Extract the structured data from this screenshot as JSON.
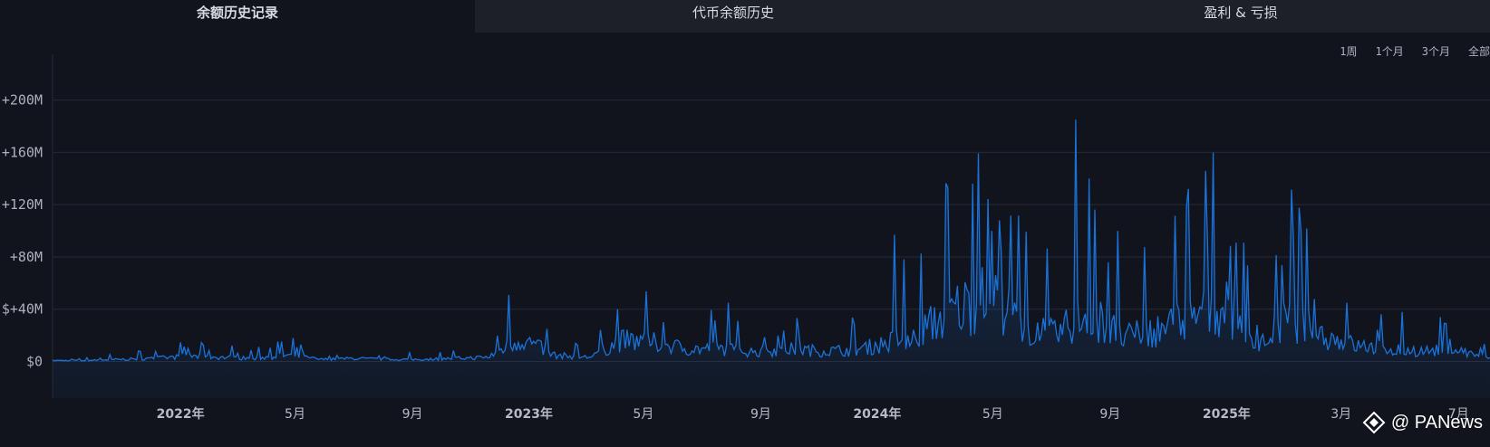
{
  "tabs": [
    {
      "label": "余额历史记录",
      "active": true
    },
    {
      "label": "代币余额历史",
      "active": false
    },
    {
      "label": "盈利 & 亏损",
      "active": false
    }
  ],
  "ranges": [
    "1周",
    "1个月",
    "3个月",
    "全部"
  ],
  "watermark": {
    "text": "@ PANews"
  },
  "colors": {
    "line": "#1a72d8",
    "background": "#12141d",
    "grid": "#262a36"
  },
  "chart_data": {
    "type": "area",
    "y_tick_labels": [
      "$0",
      "$+40M",
      "+80M",
      "+120M",
      "+160M",
      "+200M"
    ],
    "y_ticks": [
      0,
      40,
      80,
      120,
      160,
      200
    ],
    "ylim": [
      -28,
      235
    ],
    "grid": true,
    "x_ticks": [
      {
        "label": "2022年",
        "date": "2022-01-01",
        "year": true
      },
      {
        "label": "5月",
        "date": "2022-05-01",
        "year": false
      },
      {
        "label": "9月",
        "date": "2022-09-01",
        "year": false
      },
      {
        "label": "2023年",
        "date": "2023-01-01",
        "year": true
      },
      {
        "label": "5月",
        "date": "2023-05-01",
        "year": false
      },
      {
        "label": "9月",
        "date": "2023-09-01",
        "year": false
      },
      {
        "label": "2024年",
        "date": "2024-01-01",
        "year": true
      },
      {
        "label": "5月",
        "date": "2024-05-01",
        "year": false
      },
      {
        "label": "9月",
        "date": "2024-09-01",
        "year": false
      },
      {
        "label": "2025年",
        "date": "2025-01-01",
        "year": true
      },
      {
        "label": "3月",
        "date": "2025-05-01",
        "year": false
      },
      {
        "label": "7月",
        "date": "2025-09-01",
        "year": false
      }
    ],
    "series": [
      {
        "x": [
          "2021-08-20",
          "2021-09-25",
          "2021-10-30",
          "2021-12-04",
          "2022-01-08",
          "2022-02-12",
          "2022-03-19",
          "2022-04-23",
          "2022-05-28",
          "2022-07-02",
          "2022-08-06",
          "2022-09-10",
          "2022-10-15",
          "2022-11-19",
          "2022-12-24",
          "2023-01-28",
          "2023-03-04",
          "2023-04-08",
          "2023-05-13",
          "2023-06-17",
          "2023-07-22",
          "2023-08-26",
          "2023-09-30",
          "2023-11-04",
          "2023-12-09",
          "2024-01-13",
          "2024-02-17",
          "2024-03-23",
          "2024-04-27",
          "2024-06-01",
          "2024-07-06",
          "2024-08-10",
          "2024-09-14",
          "2024-10-19",
          "2024-11-23",
          "2024-12-28",
          "2025-02-01",
          "2025-03-08",
          "2025-04-12",
          "2025-05-17",
          "2025-06-21",
          "2025-07-26",
          "2025-08-30",
          "2025-10-04"
        ],
        "y": [
          1,
          1,
          2,
          3,
          5,
          4,
          3,
          6,
          2,
          3,
          2,
          2,
          3,
          4,
          22,
          6,
          4,
          20,
          18,
          12,
          12,
          9,
          12,
          10,
          11,
          18,
          30,
          50,
          62,
          35,
          25,
          48,
          22,
          30,
          40,
          55,
          12,
          42,
          25,
          15,
          12,
          10,
          11,
          3
        ]
      }
    ],
    "peaks": [
      {
        "date": "2022-12-12",
        "value": 51
      },
      {
        "date": "2023-04-05",
        "value": 40
      },
      {
        "date": "2023-07-30",
        "value": 45
      },
      {
        "date": "2024-01-20",
        "value": 97
      },
      {
        "date": "2024-04-10",
        "value": 136
      },
      {
        "date": "2024-05-08",
        "value": 108
      },
      {
        "date": "2024-07-27",
        "value": 185
      },
      {
        "date": "2024-08-10",
        "value": 140
      },
      {
        "date": "2024-09-10",
        "value": 100
      },
      {
        "date": "2024-11-22",
        "value": 132
      },
      {
        "date": "2025-01-19",
        "value": 91
      },
      {
        "date": "2025-05-07",
        "value": 45
      }
    ]
  }
}
